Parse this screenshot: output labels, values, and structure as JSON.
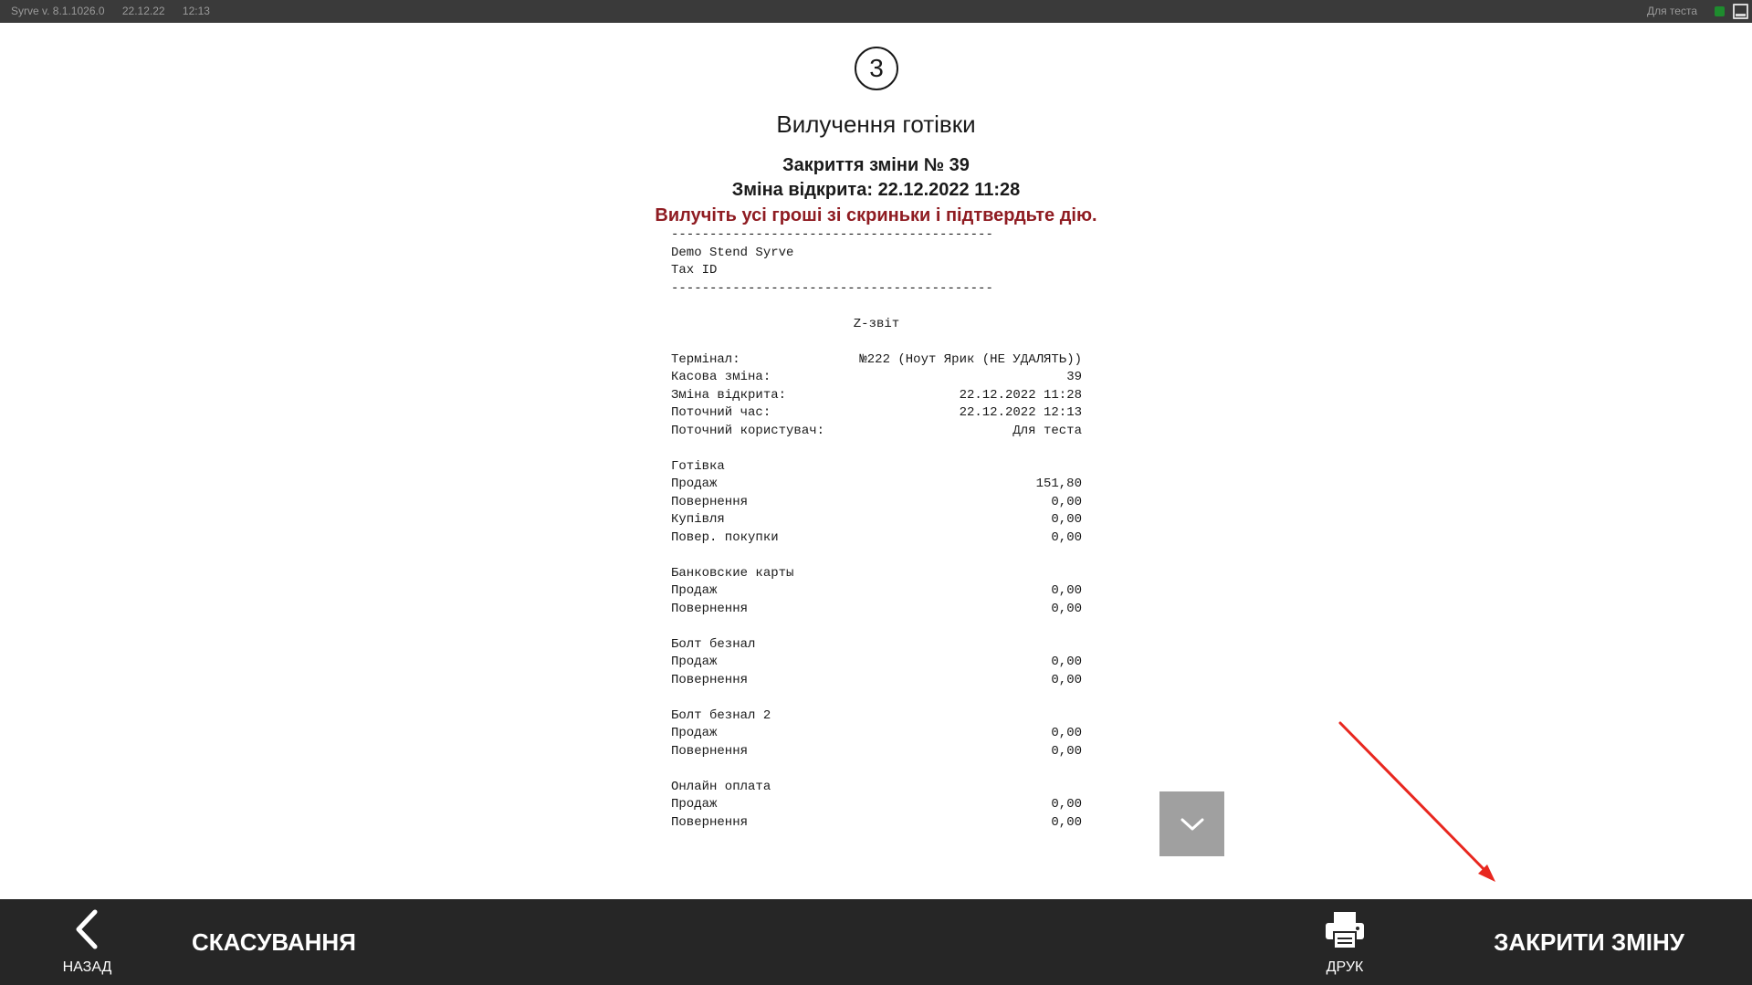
{
  "topbar": {
    "version": "Syrve v. 8.1.1026.0",
    "date": "22.12.22",
    "time": "12:13",
    "user": "Для теста",
    "status_color": "#1e8c2e"
  },
  "step": {
    "number": "3"
  },
  "page_title": "Вилучення готівки",
  "shift_title": "Закриття зміни № 39",
  "shift_opened": "Зміна відкрита: 22.12.2022 11:28",
  "warning": "Вилучіть усі гроші зі скриньки і підтвердьте дію.",
  "receipt": {
    "separator": "------------------------------------------",
    "company": "Demo Stend Syrve",
    "tax_id": "Tax ID",
    "report_title": "Z-звіт",
    "info": [
      {
        "label": "Термінал:",
        "value": "№222 (Ноут Ярик (НЕ УДАЛЯТЬ))"
      },
      {
        "label": "Касова зміна:",
        "value": "39"
      },
      {
        "label": "Зміна відкрита:",
        "value": "22.12.2022 11:28"
      },
      {
        "label": "Поточний час:",
        "value": "22.12.2022 12:13"
      },
      {
        "label": "Поточний користувач:",
        "value": "Для теста"
      }
    ],
    "cash": {
      "title": "Готівка",
      "rows": [
        {
          "label": "Продаж",
          "value": "151,80"
        },
        {
          "label": "Повернення",
          "value": "0,00"
        },
        {
          "label": "Купівля",
          "value": "0,00"
        },
        {
          "label": "Повер. покупки",
          "value": "0,00"
        }
      ]
    },
    "bank_cards": {
      "title": "Банковские карты",
      "rows": [
        {
          "label": "Продаж",
          "value": "0,00"
        },
        {
          "label": "Повернення",
          "value": "0,00"
        }
      ]
    },
    "bolt": {
      "title": "Болт безнал",
      "rows": [
        {
          "label": "Продаж",
          "value": "0,00"
        },
        {
          "label": "Повернення",
          "value": "0,00"
        }
      ]
    },
    "bolt2": {
      "title": "Болт безнал 2",
      "rows": [
        {
          "label": "Продаж",
          "value": "0,00"
        },
        {
          "label": "Повернення",
          "value": "0,00"
        }
      ]
    },
    "online": {
      "title": "Онлайн оплата",
      "rows": [
        {
          "label": "Продаж",
          "value": "0,00"
        },
        {
          "label": "Повернення",
          "value": "0,00"
        }
      ]
    },
    "trailing": "-"
  },
  "bottombar": {
    "back_label": "НАЗАД",
    "cancel_label": "СКАСУВАННЯ",
    "print_label": "ДРУК",
    "close_shift_label": "ЗАКРИТИ ЗМІНУ"
  },
  "icons": {
    "back": "chevron-left-icon",
    "print": "printer-icon",
    "scroll_down": "chevron-down-icon"
  },
  "colors": {
    "warning": "#8f1c22",
    "bottombar": "#262626",
    "annotation_arrow": "#e8271f"
  }
}
